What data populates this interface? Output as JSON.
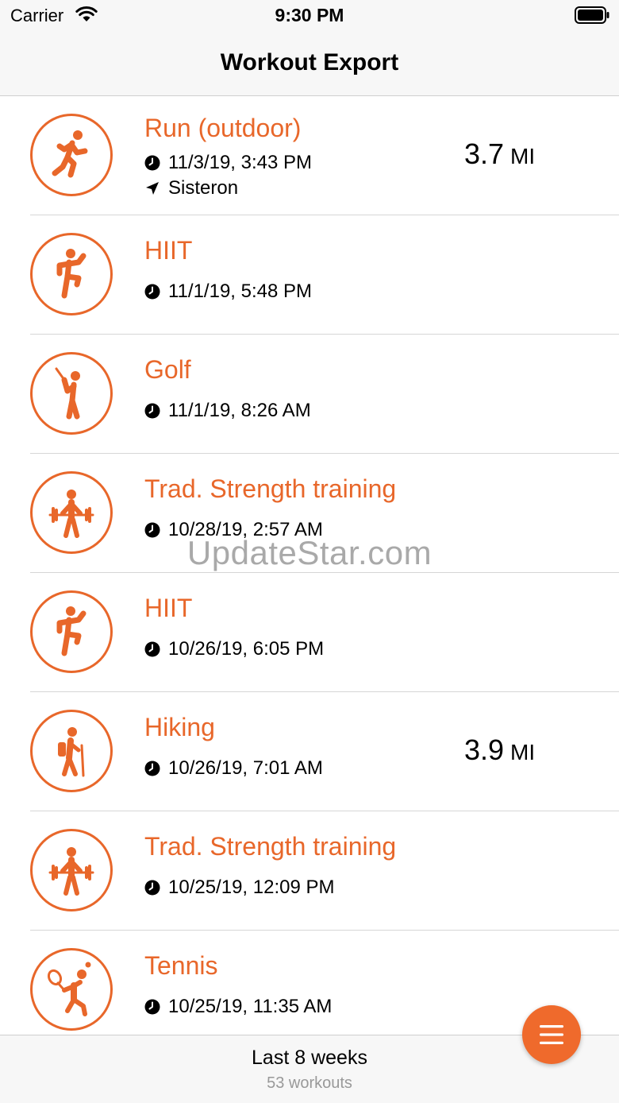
{
  "status_bar": {
    "carrier": "Carrier",
    "time": "9:30 PM"
  },
  "nav": {
    "title": "Workout Export"
  },
  "workouts": [
    {
      "title": "Run (outdoor)",
      "date": "11/3/19, 3:43 PM",
      "location": "Sisteron",
      "distance": "3.7",
      "unit": "MI",
      "icon": "running-icon"
    },
    {
      "title": "HIIT",
      "date": "11/1/19, 5:48 PM",
      "icon": "hiit-icon"
    },
    {
      "title": "Golf",
      "date": "11/1/19, 8:26 AM",
      "icon": "golf-icon"
    },
    {
      "title": "Trad. Strength training",
      "date": "10/28/19, 2:57 AM",
      "icon": "weightlifting-icon"
    },
    {
      "title": "HIIT",
      "date": "10/26/19, 6:05 PM",
      "icon": "hiit-icon"
    },
    {
      "title": "Hiking",
      "date": "10/26/19, 7:01 AM",
      "distance": "3.9",
      "unit": "MI",
      "icon": "hiking-icon"
    },
    {
      "title": "Trad. Strength training",
      "date": "10/25/19, 12:09 PM",
      "icon": "weightlifting-icon"
    },
    {
      "title": "Tennis",
      "date": "10/25/19, 11:35 AM",
      "icon": "tennis-icon"
    }
  ],
  "watermark": "UpdateStar.com",
  "footer": {
    "range": "Last 8 weeks",
    "count": "53 workouts"
  },
  "fab": {
    "icon": "menu-icon"
  },
  "colors": {
    "accent": "#e8672a"
  }
}
